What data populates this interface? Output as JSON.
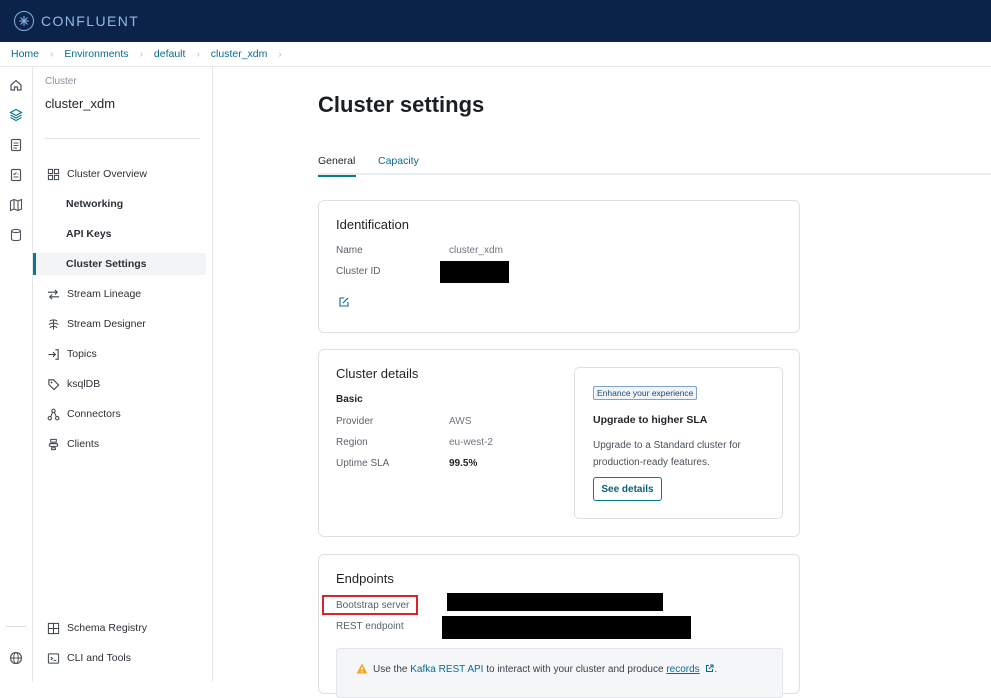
{
  "header": {
    "brand": "CONFLUENT"
  },
  "breadcrumb": [
    "Home",
    "Environments",
    "default",
    "cluster_xdm"
  ],
  "sidenav": {
    "caption": "Cluster",
    "cluster_name": "cluster_xdm",
    "items": [
      {
        "label": "Cluster Overview",
        "icon": "grid-icon"
      },
      {
        "label": "Networking",
        "sub": true
      },
      {
        "label": "API Keys",
        "sub": true
      },
      {
        "label": "Cluster Settings",
        "sub": true,
        "active": true
      },
      {
        "label": "Stream Lineage",
        "icon": "arrows-icon"
      },
      {
        "label": "Stream Designer",
        "icon": "designer-icon"
      },
      {
        "label": "Topics",
        "icon": "topics-icon"
      },
      {
        "label": "ksqlDB",
        "icon": "ksqldb-icon"
      },
      {
        "label": "Connectors",
        "icon": "connectors-icon"
      },
      {
        "label": "Clients",
        "icon": "clients-icon"
      }
    ],
    "bottom_items": [
      {
        "label": "Schema Registry",
        "icon": "schema-icon"
      },
      {
        "label": "CLI and Tools",
        "icon": "terminal-icon"
      }
    ]
  },
  "page": {
    "title": "Cluster settings",
    "tabs": [
      "General",
      "Capacity"
    ]
  },
  "identification": {
    "title": "Identification",
    "name_label": "Name",
    "name_value": "cluster_xdm",
    "id_label": "Cluster ID"
  },
  "details": {
    "title": "Cluster details",
    "plan": "Basic",
    "provider_label": "Provider",
    "provider_value": "AWS",
    "region_label": "Region",
    "region_value": "eu-west-2",
    "sla_label": "Uptime SLA",
    "sla_value": "99.5%",
    "promo": {
      "badge": "Enhance your experience",
      "heading": "Upgrade to higher SLA",
      "text": "Upgrade to a Standard cluster for production-ready features.",
      "button": "See details"
    }
  },
  "endpoints": {
    "title": "Endpoints",
    "bootstrap_label": "Bootstrap server",
    "rest_label": "REST endpoint",
    "notice": {
      "pre": "Use the ",
      "link1": "Kafka REST API",
      "mid": " to interact with your cluster and produce ",
      "link2": "records"
    }
  },
  "colors": {
    "topbar": "#0b2249",
    "accent": "#0a7a8c",
    "link": "#0a6a93",
    "highlight": "#d9242c"
  }
}
